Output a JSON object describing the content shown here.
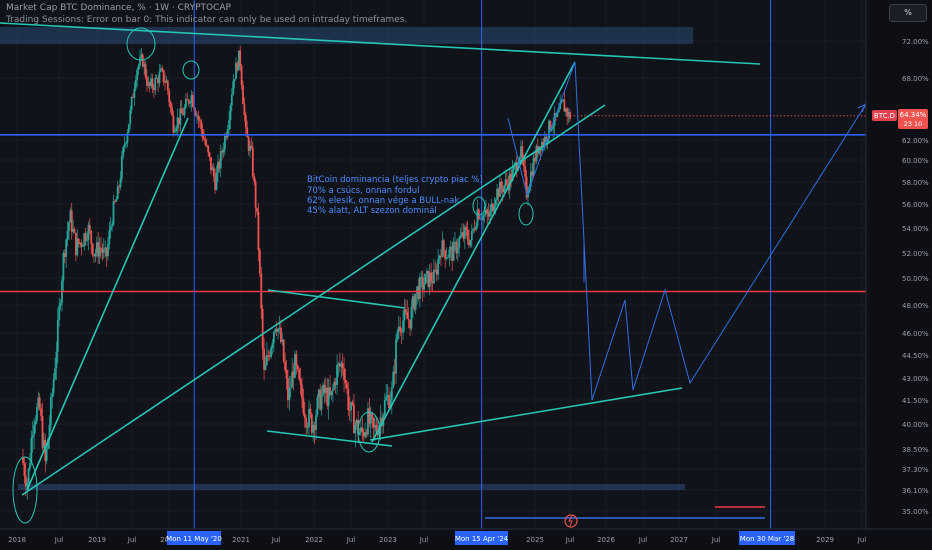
{
  "header": {
    "title": "Market Cap BTC Dominance, % · 1W · CRYPTOCAP",
    "warning": "Trading Sessions: Error on bar 0: This indicator can only be used on intraday timeframes."
  },
  "scale_button": "%",
  "annotation": [
    "BitCoin dominancia (teljes crypto piac %)",
    "70% a csúcs, onnan fordul",
    "62% elesik, onnan vége a BULL-nak",
    "45% alatt, ALT szezon dominál"
  ],
  "price_badge": {
    "label": "BTC.D",
    "value": "64.34%",
    "countdown": "23 10"
  },
  "marker_labels": [
    "Mon 11 May '20",
    "Mon 15 Apr '24",
    "Mon 30 Mar '28"
  ],
  "colors": {
    "background": "#0d0f14",
    "candle_up": "#26a69a",
    "candle_down": "#ef5350",
    "trend": "#26c6b5",
    "blue": "#2962ff",
    "red": "#f23645",
    "projection": "#2f6fde"
  },
  "chart_data": {
    "type": "candlestick",
    "title": "Market Cap BTC Dominance, % · 1W · CRYPTOCAP",
    "x_ticks": [
      "2018",
      "Jul",
      "2019",
      "Jul",
      "2020",
      "2021",
      "Jul",
      "2022",
      "Jul",
      "2023",
      "Jul",
      "2025",
      "Jul",
      "2026",
      "Jul",
      "2027",
      "Jul",
      "2029",
      "Jul"
    ],
    "y_ticks": [
      "72.00%",
      "68.00%",
      "62.00%",
      "60.00%",
      "58.00%",
      "56.00%",
      "54.00%",
      "52.00%",
      "50.00%",
      "48.00%",
      "46.00%",
      "44.50%",
      "43.00%",
      "41.50%",
      "40.00%",
      "38.50%",
      "37.30%",
      "36.10%",
      "35.00%"
    ],
    "y_tick_values": [
      72,
      68,
      62,
      60,
      58,
      56,
      54,
      52,
      50,
      48,
      46,
      44.5,
      43,
      41.5,
      40,
      38.5,
      37.3,
      36.1,
      35
    ],
    "price_anchors": [
      [
        "2018-01-01",
        38.0
      ],
      [
        "2018-02-01",
        36.5
      ],
      [
        "2018-03-01",
        40.5
      ],
      [
        "2018-04-01",
        41.0
      ],
      [
        "2018-05-01",
        37.5
      ],
      [
        "2018-06-01",
        41.5
      ],
      [
        "2018-07-01",
        46.0
      ],
      [
        "2018-08-01",
        52.0
      ],
      [
        "2018-09-01",
        55.0
      ],
      [
        "2018-10-01",
        52.5
      ],
      [
        "2018-11-01",
        53.0
      ],
      [
        "2018-12-01",
        54.0
      ],
      [
        "2019-01-01",
        52.0
      ],
      [
        "2019-02-01",
        52.5
      ],
      [
        "2019-03-01",
        51.5
      ],
      [
        "2019-04-01",
        55.0
      ],
      [
        "2019-05-01",
        57.0
      ],
      [
        "2019-06-01",
        61.5
      ],
      [
        "2019-07-01",
        64.5
      ],
      [
        "2019-08-01",
        69.0
      ],
      [
        "2019-09-01",
        70.0
      ],
      [
        "2019-10-01",
        67.0
      ],
      [
        "2019-11-01",
        67.5
      ],
      [
        "2019-12-01",
        68.5
      ],
      [
        "2020-01-01",
        67.5
      ],
      [
        "2020-02-01",
        63.5
      ],
      [
        "2020-03-01",
        64.0
      ],
      [
        "2020-04-01",
        65.0
      ],
      [
        "2020-05-01",
        66.5
      ],
      [
        "2020-06-01",
        64.5
      ],
      [
        "2020-07-01",
        62.5
      ],
      [
        "2020-08-01",
        60.0
      ],
      [
        "2020-09-01",
        58.0
      ],
      [
        "2020-10-01",
        60.5
      ],
      [
        "2020-11-01",
        63.5
      ],
      [
        "2020-12-01",
        68.0
      ],
      [
        "2021-01-01",
        70.5
      ],
      [
        "2021-02-01",
        62.5
      ],
      [
        "2021-03-01",
        60.5
      ],
      [
        "2021-04-01",
        54.0
      ],
      [
        "2021-05-01",
        43.0
      ],
      [
        "2021-06-01",
        45.0
      ],
      [
        "2021-07-01",
        47.0
      ],
      [
        "2021-08-01",
        45.0
      ],
      [
        "2021-09-01",
        41.5
      ],
      [
        "2021-10-01",
        44.0
      ],
      [
        "2021-11-01",
        42.0
      ],
      [
        "2021-12-01",
        40.5
      ],
      [
        "2022-01-01",
        40.0
      ],
      [
        "2022-02-01",
        41.5
      ],
      [
        "2022-03-01",
        42.0
      ],
      [
        "2022-04-01",
        41.5
      ],
      [
        "2022-05-01",
        43.5
      ],
      [
        "2022-06-01",
        44.0
      ],
      [
        "2022-07-01",
        41.0
      ],
      [
        "2022-08-01",
        40.0
      ],
      [
        "2022-09-01",
        39.3
      ],
      [
        "2022-10-01",
        40.3
      ],
      [
        "2022-11-01",
        39.5
      ],
      [
        "2022-12-01",
        40.2
      ],
      [
        "2023-01-01",
        41.5
      ],
      [
        "2023-02-01",
        42.0
      ],
      [
        "2023-03-01",
        46.5
      ],
      [
        "2023-04-01",
        47.0
      ],
      [
        "2023-05-01",
        47.0
      ],
      [
        "2023-06-01",
        49.0
      ],
      [
        "2023-07-01",
        49.5
      ],
      [
        "2023-08-01",
        50.0
      ],
      [
        "2023-09-01",
        50.0
      ],
      [
        "2023-10-01",
        52.5
      ],
      [
        "2023-11-01",
        52.0
      ],
      [
        "2023-12-01",
        52.0
      ],
      [
        "2024-01-01",
        53.0
      ],
      [
        "2024-02-01",
        53.5
      ],
      [
        "2024-03-01",
        53.0
      ],
      [
        "2024-04-01",
        55.5
      ],
      [
        "2024-05-01",
        55.0
      ],
      [
        "2024-06-01",
        55.0
      ],
      [
        "2024-07-01",
        57.0
      ],
      [
        "2024-08-01",
        57.5
      ],
      [
        "2024-09-01",
        58.0
      ],
      [
        "2024-10-01",
        59.0
      ],
      [
        "2024-11-01",
        61.0
      ],
      [
        "2024-12-01",
        57.0
      ],
      [
        "2025-01-01",
        59.5
      ],
      [
        "2025-02-01",
        61.5
      ],
      [
        "2025-03-01",
        62.0
      ],
      [
        "2025-04-01",
        63.5
      ],
      [
        "2025-05-01",
        64.0
      ],
      [
        "2025-06-01",
        65.5
      ],
      [
        "2025-07-01",
        64.34
      ]
    ],
    "current": 64.34,
    "horizontal_levels": [
      {
        "name": "blue",
        "value": 62.5
      },
      {
        "name": "red",
        "value": 49.0
      }
    ]
  }
}
